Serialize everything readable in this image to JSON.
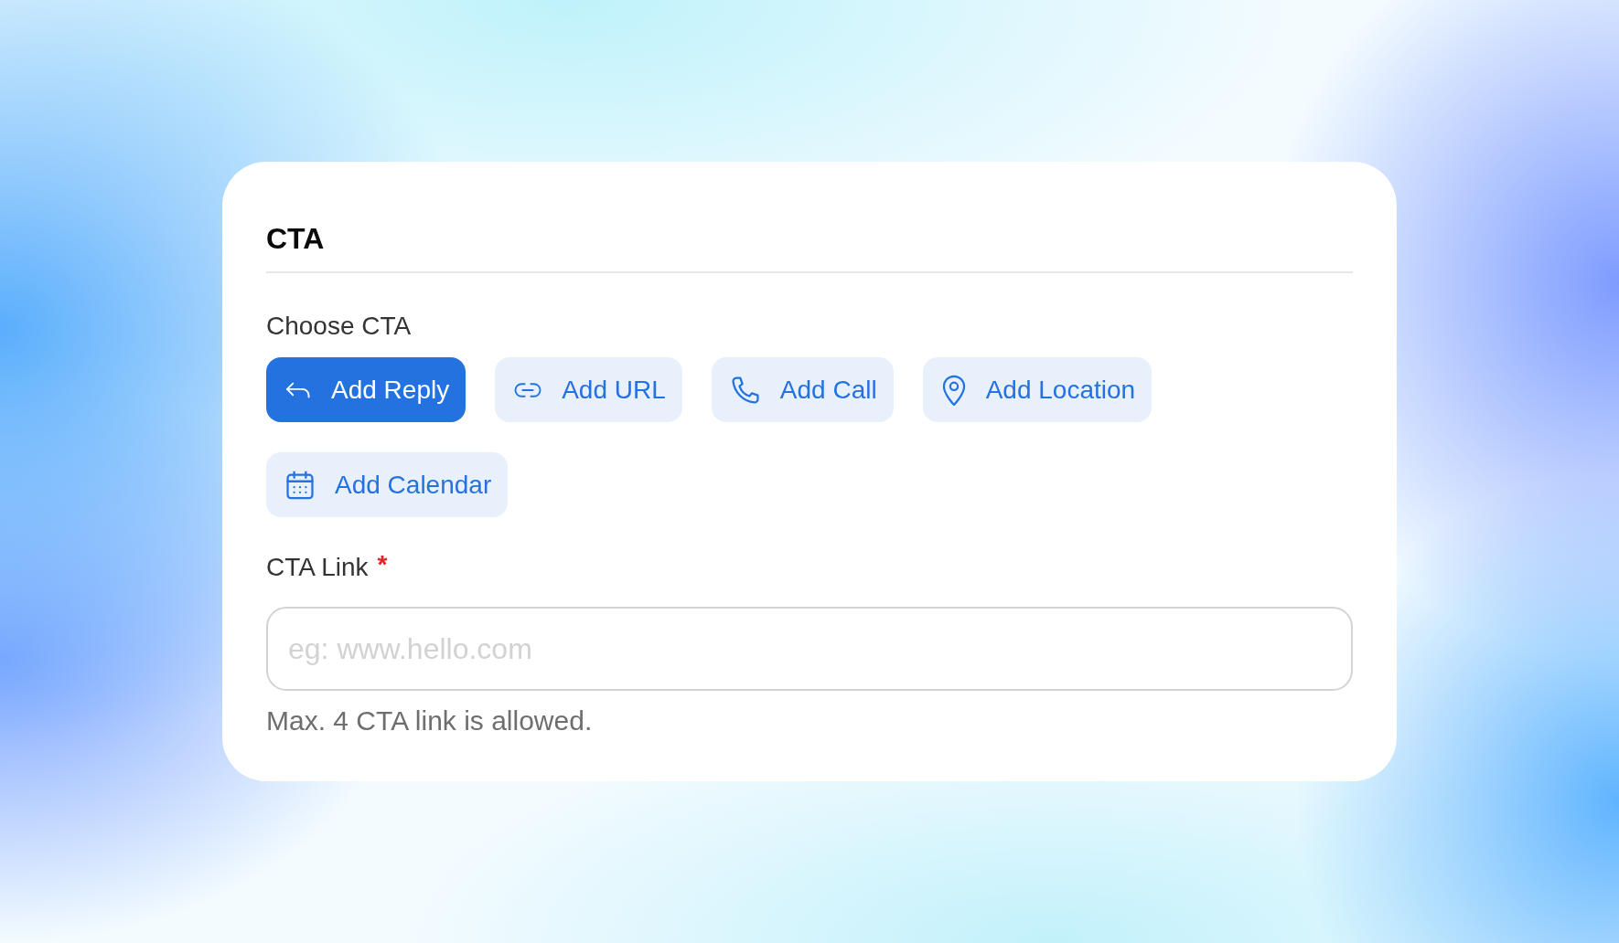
{
  "card": {
    "title": "CTA"
  },
  "cta_picker": {
    "label": "Choose CTA",
    "options": [
      {
        "label": "Add Reply",
        "kind": "reply",
        "selected": true
      },
      {
        "label": "Add URL",
        "kind": "url",
        "selected": false
      },
      {
        "label": "Add Call",
        "kind": "call",
        "selected": false
      },
      {
        "label": "Add Location",
        "kind": "location",
        "selected": false
      },
      {
        "label": "Add Calendar",
        "kind": "calendar",
        "selected": false
      }
    ]
  },
  "cta_link": {
    "label": "CTA Link",
    "required_mark": "*",
    "placeholder": "eg: www.hello.com",
    "help": "Max. 4 CTA link is allowed."
  }
}
